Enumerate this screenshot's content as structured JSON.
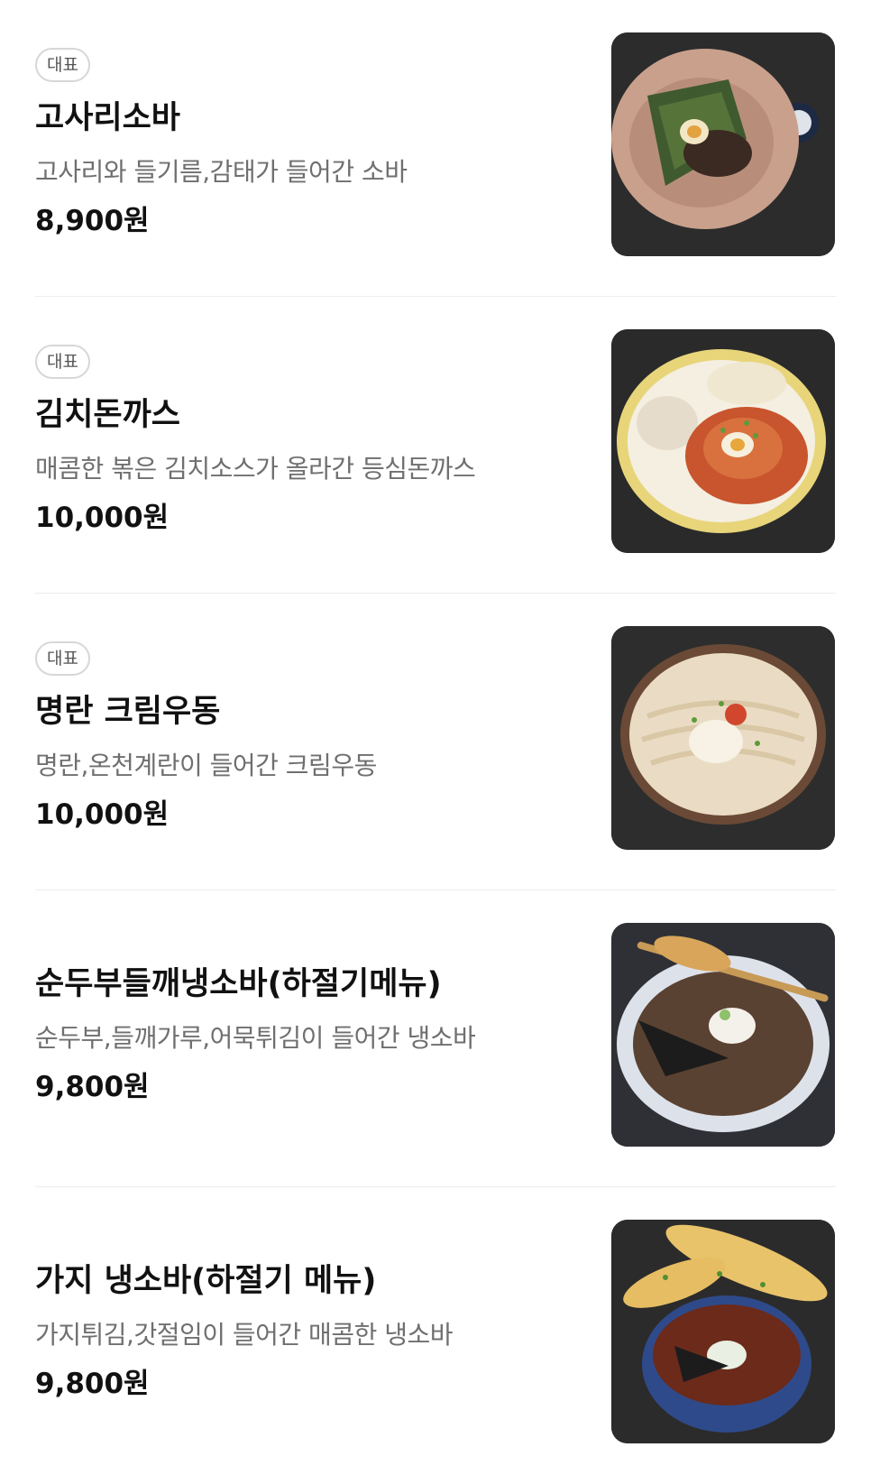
{
  "menu": {
    "items": [
      {
        "badge": "대표",
        "name": "고사리소바",
        "description": "고사리와 들기름,감태가 들어간 소바",
        "price": "8,900원",
        "image_icon": "soba-bowl-icon"
      },
      {
        "badge": "대표",
        "name": "김치돈까스",
        "description": "매콤한 볶은 김치소스가 올라간 등심돈까스",
        "price": "10,000원",
        "image_icon": "kimchi-tonkatsu-plate-icon"
      },
      {
        "badge": "대표",
        "name": "명란 크림우동",
        "description": "명란,온천계란이 들어간 크림우동",
        "price": "10,000원",
        "image_icon": "cream-udon-bowl-icon"
      },
      {
        "name": "순두부들깨냉소바(하절기메뉴)",
        "description": "순두부,들깨가루,어묵튀김이 들어간 냉소바",
        "price": "9,800원",
        "image_icon": "cold-soba-bowl-icon"
      },
      {
        "name": "가지 냉소바(하절기 메뉴)",
        "description": "가지튀김,갓절임이 들어간 매콤한 냉소바",
        "price": "9,800원",
        "image_icon": "eggplant-soba-bowl-icon"
      }
    ]
  }
}
